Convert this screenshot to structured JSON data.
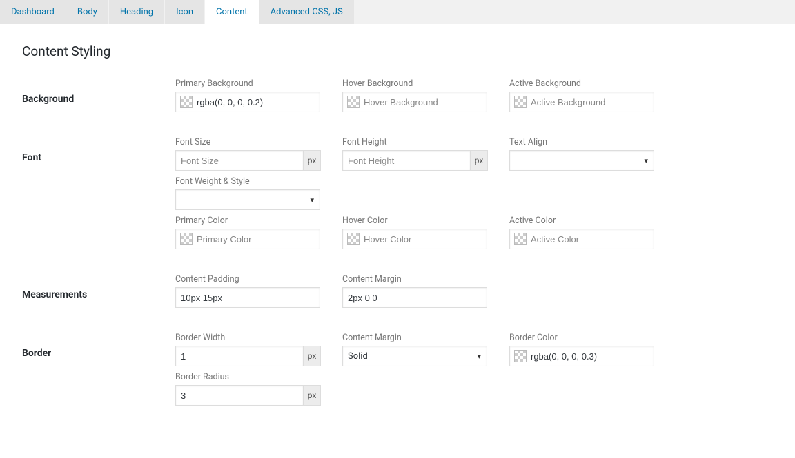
{
  "tabs": {
    "dashboard": "Dashboard",
    "body": "Body",
    "heading": "Heading",
    "icon": "Icon",
    "content": "Content",
    "advanced": "Advanced CSS, JS"
  },
  "panel_title": "Content Styling",
  "units": {
    "px": "px"
  },
  "sections": {
    "background": {
      "label": "Background",
      "primary_bg_label": "Primary Background",
      "primary_bg_value": "rgba(0, 0, 0, 0.2)",
      "hover_bg_label": "Hover Background",
      "hover_bg_placeholder": "Hover Background",
      "active_bg_label": "Active Background",
      "active_bg_placeholder": "Active Background"
    },
    "font": {
      "label": "Font",
      "font_size_label": "Font Size",
      "font_size_placeholder": "Font Size",
      "font_height_label": "Font Height",
      "font_height_placeholder": "Font Height",
      "text_align_label": "Text Align",
      "text_align_value": "",
      "weight_style_label": "Font Weight & Style",
      "weight_style_value": "",
      "primary_color_label": "Primary Color",
      "primary_color_placeholder": "Primary Color",
      "hover_color_label": "Hover Color",
      "hover_color_placeholder": "Hover Color",
      "active_color_label": "Active Color",
      "active_color_placeholder": "Active Color"
    },
    "measurements": {
      "label": "Measurements",
      "padding_label": "Content Padding",
      "padding_value": "10px 15px",
      "margin_label": "Content Margin",
      "margin_value": "2px 0 0"
    },
    "border": {
      "label": "Border",
      "width_label": "Border Width",
      "width_value": "1",
      "style_label": "Content Margin",
      "style_value": "Solid",
      "color_label": "Border Color",
      "color_value": "rgba(0, 0, 0, 0.3)",
      "radius_label": "Border Radius",
      "radius_value": "3"
    }
  }
}
